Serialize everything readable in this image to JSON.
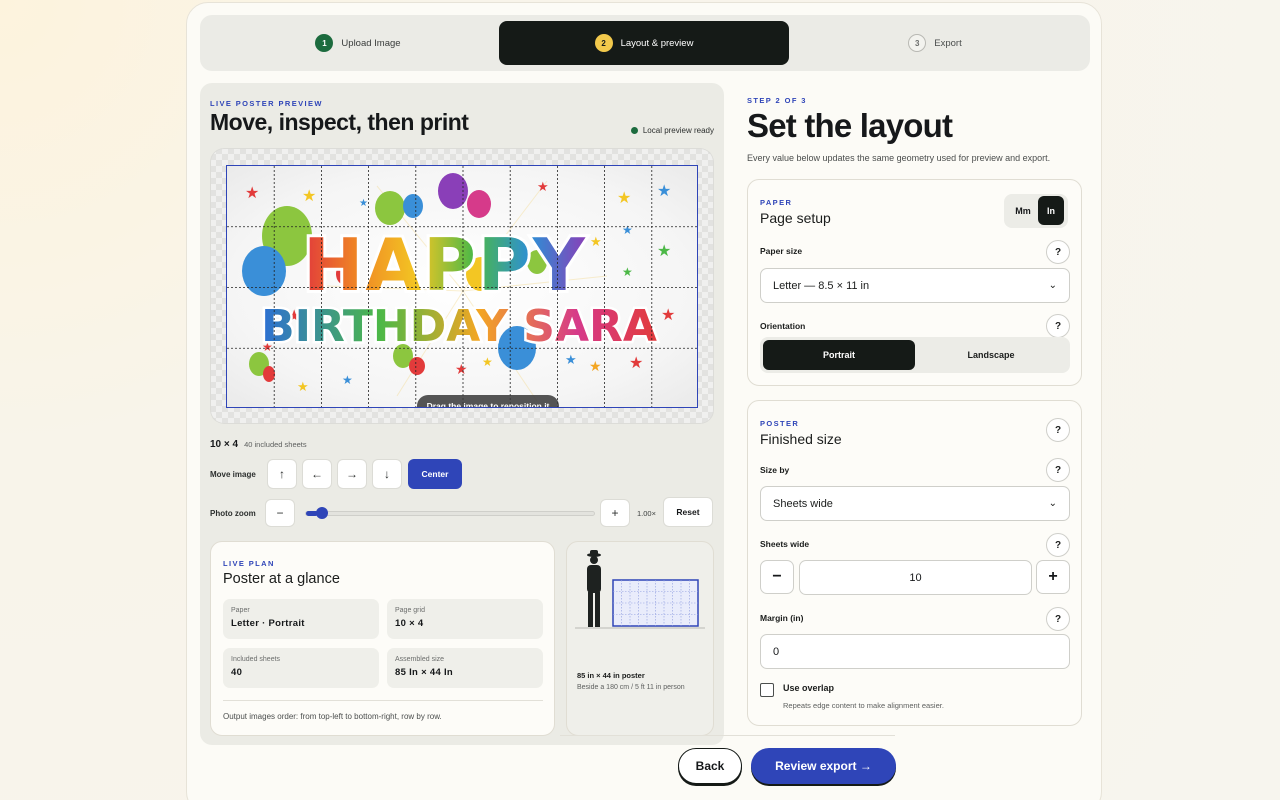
{
  "stepper": {
    "steps": [
      {
        "num": "1",
        "label": "Upload Image"
      },
      {
        "num": "2",
        "label": "Layout & preview"
      },
      {
        "num": "3",
        "label": "Export"
      }
    ]
  },
  "preview": {
    "eyebrow": "LIVE POSTER PREVIEW",
    "title": "Move, inspect, then print",
    "status": "Local preview ready",
    "status_color": "#1c6b3e",
    "poster_line1": "HAPPY",
    "poster_line2": "BIRTHDAY SARA",
    "drag_tip": "Drag the image to reposition it",
    "grid_size": "10 × 4",
    "grid_sheets": "40 included sheets",
    "grid_cols": 10,
    "grid_rows": 4
  },
  "controls": {
    "move_label": "Move image",
    "move_buttons": [
      "↑",
      "←",
      "→",
      "↓"
    ],
    "center_label": "Center",
    "zoom_label": "Photo zoom",
    "zoom_minus": "−",
    "zoom_plus": "+",
    "zoom_value": "1.00×",
    "zoom_fraction": 0.04,
    "reset_label": "Reset"
  },
  "plan": {
    "eyebrow": "LIVE PLAN",
    "title": "Poster at a glance",
    "stats": [
      {
        "label": "Paper",
        "value": "Letter · Portrait"
      },
      {
        "label": "Page grid",
        "value": "10 × 4"
      },
      {
        "label": "Included sheets",
        "value": "40"
      },
      {
        "label": "Assembled size",
        "value": "85 In × 44 In"
      }
    ],
    "order_note": "Output images order: from top-left to bottom-right, row by row."
  },
  "scale": {
    "caption": "85 in × 44 in poster",
    "subcaption": "Beside a 180 cm / 5 ft 11 in person"
  },
  "setup": {
    "eyebrow": "STEP 2 OF 3",
    "title": "Set the layout",
    "description": "Every value below updates the same geometry used for preview and export."
  },
  "paper_card": {
    "eyebrow": "PAPER",
    "title": "Page setup",
    "unit_mm": "Mm",
    "unit_in": "In",
    "paper_size_label": "Paper size",
    "paper_size_value": "Letter — 8.5 × 11 in",
    "orientation_label": "Orientation",
    "orientation_portrait": "Portrait",
    "orientation_landscape": "Landscape",
    "help": "?"
  },
  "poster_card": {
    "eyebrow": "POSTER",
    "title": "Finished size",
    "size_by_label": "Size by",
    "size_by_value": "Sheets wide",
    "sheets_wide_label": "Sheets wide",
    "sheets_wide_value": "10",
    "minus": "−",
    "plus": "+",
    "margin_label": "Margin (in)",
    "margin_value": "0",
    "overlap_label": "Use overlap",
    "overlap_help": "Repeats edge content to make alignment easier.",
    "help": "?"
  },
  "footer": {
    "back_label": "Back",
    "review_label": "Review export →"
  },
  "colors": {
    "accent": "#2f45b8",
    "dark": "#151a17",
    "step_done": "#1c6b3e",
    "step_active_badge": "#f2c94c"
  }
}
